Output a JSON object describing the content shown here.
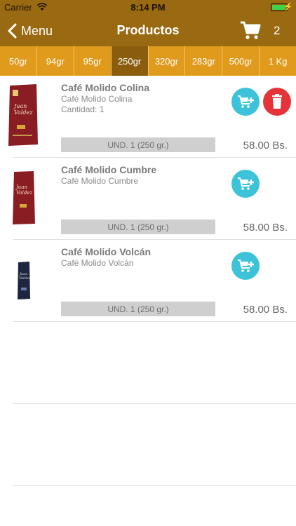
{
  "status": {
    "carrier": "Carrier",
    "time": "8:14 PM"
  },
  "nav": {
    "back_label": "Menu",
    "title": "Productos",
    "cart_count": "2"
  },
  "weights": [
    "50gr",
    "94gr",
    "95gr",
    "250gr",
    "320gr",
    "283gr",
    "500gr",
    "1 Kg"
  ],
  "selected_weight": "250gr",
  "products": [
    {
      "name": "Café Molido Colina",
      "desc": "Café Molido Colina",
      "qty": "Cantidad: 1",
      "unit": "UND. 1     (250 gr.)",
      "price": "58.00 Bs.",
      "in_cart": true
    },
    {
      "name": "Café Molido Cumbre",
      "desc": "Café Molido Cumbre",
      "qty": "",
      "unit": "UND. 1     (250 gr.)",
      "price": "58.00 Bs.",
      "in_cart": false
    },
    {
      "name": "Café Molido Volcán",
      "desc": "Café Molido Volcán",
      "qty": "",
      "unit": "UND. 1     (250 gr.)",
      "price": "58.00 Bs.",
      "in_cart": false
    }
  ],
  "colors": {
    "nav": "#9a6a12",
    "tabs": "#e09a1c",
    "tab_active": "#8a5c0d",
    "add": "#3cc3d9",
    "delete": "#e5333a"
  },
  "icons": {
    "back": "chevron-left-icon",
    "cart": "shopping-cart-icon",
    "add_to_cart": "cart-plus-icon",
    "delete": "trash-icon"
  }
}
